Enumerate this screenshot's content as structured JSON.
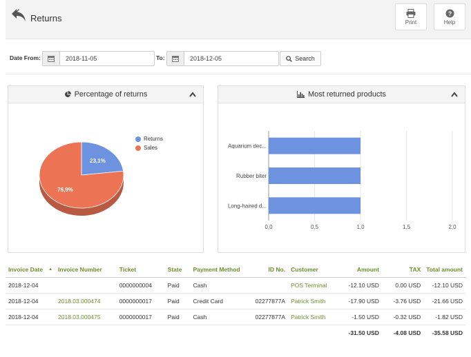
{
  "header": {
    "title": "Returns",
    "print_label": "Print",
    "help_label": "Help"
  },
  "filter": {
    "date_from_label": "Date From:",
    "date_from_value": "2018-11-05",
    "to_label": "To:",
    "date_to_value": "2018-12-05",
    "search_label": "Search"
  },
  "pie_panel": {
    "title": "Percentage of returns",
    "legend": [
      {
        "name": "Returns",
        "color": "#6d93e0"
      },
      {
        "name": "Sales",
        "color": "#ec7454"
      }
    ]
  },
  "bar_panel": {
    "title": "Most returned products"
  },
  "chart_data": [
    {
      "type": "pie",
      "labels": [
        "Returns",
        "Sales"
      ],
      "values": [
        23.1,
        76.9
      ],
      "data_labels": [
        "23,1%",
        "76,9%"
      ],
      "colors": [
        "#6d93e0",
        "#ec7454"
      ],
      "legend_position": "right"
    },
    {
      "type": "bar",
      "orientation": "horizontal",
      "categories": [
        "Aquarium dec...",
        "Rubber biter",
        "Long-haired d..."
      ],
      "values": [
        1.0,
        1.0,
        1.0
      ],
      "xlim": [
        0,
        2
      ],
      "xticks": [
        "0,0",
        "0,5",
        "1,0",
        "1,5",
        "2,0"
      ],
      "color": "#6d93e0",
      "grid": true
    }
  ],
  "table": {
    "columns": [
      "Invoice Date",
      "Invoice Number",
      "Ticket",
      "State",
      "Payment Method",
      "ID No.",
      "Customer",
      "Amount",
      "TAX",
      "Total amount"
    ],
    "rows": [
      [
        "2018-12-04",
        "",
        "0000000004",
        "Paid",
        "Cash",
        "",
        "POS Terminal",
        "-12.10 USD",
        "0.00 USD",
        "-12.10 USD"
      ],
      [
        "2018-12-04",
        "2018.03.000474",
        "0000000017",
        "Paid",
        "Credit Card",
        "02277877A",
        "Patrick Smith",
        "-17.90 USD",
        "-3.76 USD",
        "-21.66 USD"
      ],
      [
        "2018-12-04",
        "2018.03.000475",
        "0000000017",
        "Paid",
        "Cash",
        "02277877A",
        "Patrick Smith",
        "-1.50 USD",
        "-0.32 USD",
        "-1.82 USD"
      ]
    ],
    "totals": {
      "amount": "-31.50 USD",
      "tax": "-4.08 USD",
      "total": "-35.58 USD"
    }
  }
}
